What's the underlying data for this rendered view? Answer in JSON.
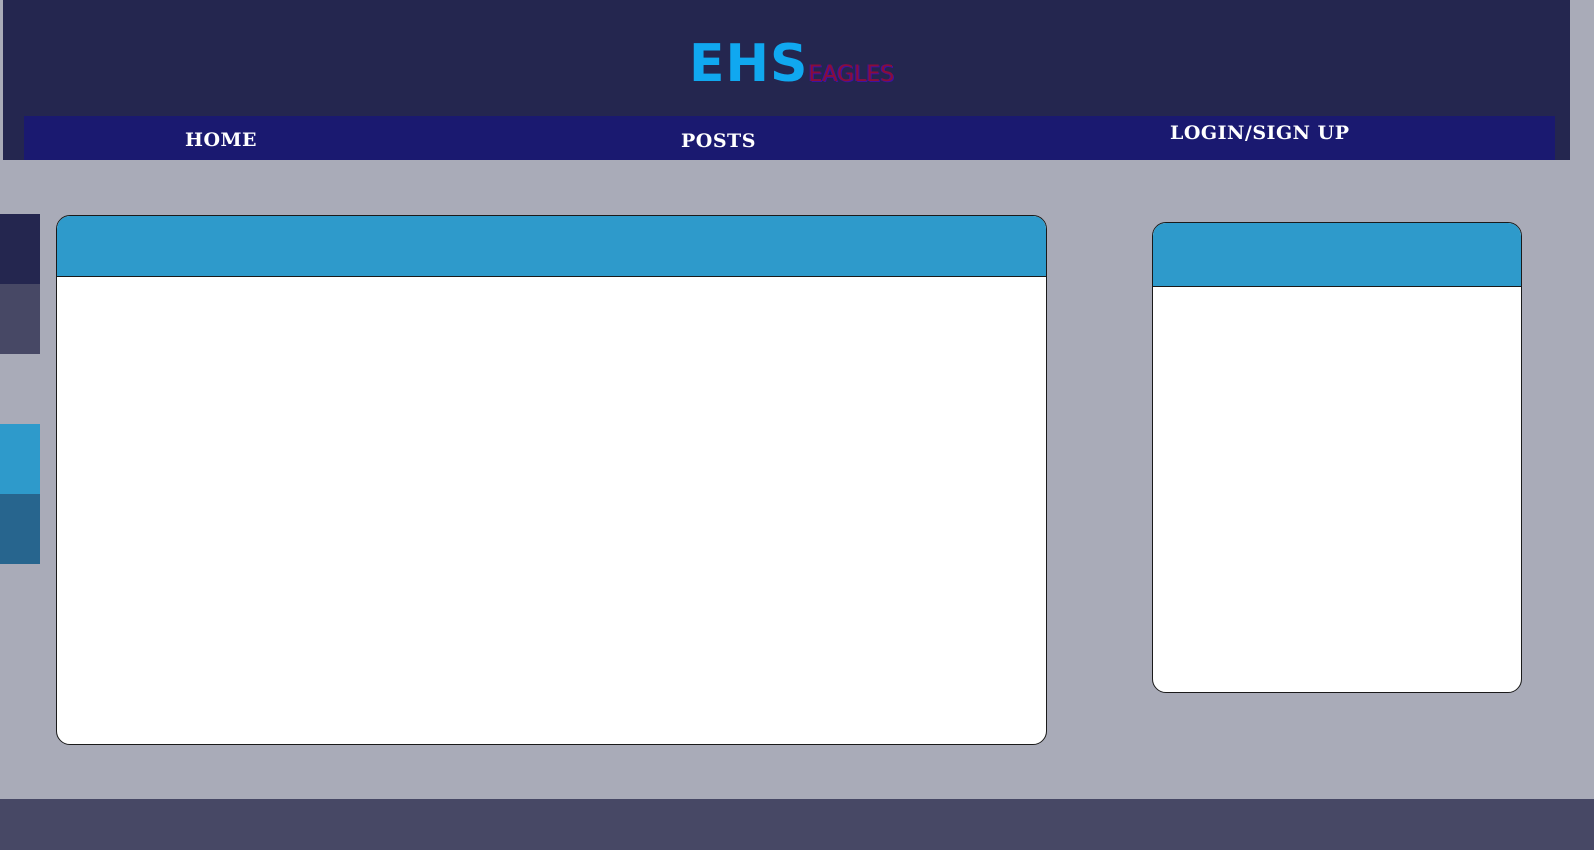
{
  "logo": {
    "main": "EHS",
    "sub": "EAGLES"
  },
  "nav": {
    "items": [
      {
        "label": "HOME"
      },
      {
        "label": "POSTS"
      },
      {
        "label": "LOGIN/SIGN UP"
      }
    ]
  },
  "palette": {
    "swatches": [
      "#24264f",
      "#474865",
      "#a9abb8",
      "#2e9acb",
      "#27658e"
    ]
  },
  "colors": {
    "header_bg": "#24264f",
    "nav_bg": "#1a1970",
    "page_bg": "#a9abb8",
    "card_header": "#2e9acb",
    "footer_bg": "#474865",
    "logo_main": "#10a8f0",
    "logo_sub": "#8a0d3a"
  }
}
